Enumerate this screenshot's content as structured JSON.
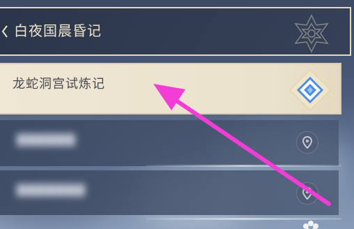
{
  "chapter": {
    "title": "白夜国晨昏记"
  },
  "quests": [
    {
      "title": "龙蛇洞宫试炼记",
      "selected": true,
      "icon": "quest-diamond-icon"
    },
    {
      "title": "",
      "selected": false,
      "icon": "map-pin-icon",
      "blurred": true
    },
    {
      "title": "",
      "selected": false,
      "icon": "map-pin-icon",
      "blurred": true
    }
  ],
  "colors": {
    "header_border": "#e3d9bf",
    "selected_bg": "#efe7d4",
    "annotation_arrow": "#f23cd6",
    "diamond_blue": "#4f8fe0"
  },
  "icons": {
    "chapter_chevron": "chevron-left-icon",
    "chapter_emblem": "chapter-emblem-icon",
    "corner": "flower-icon"
  }
}
